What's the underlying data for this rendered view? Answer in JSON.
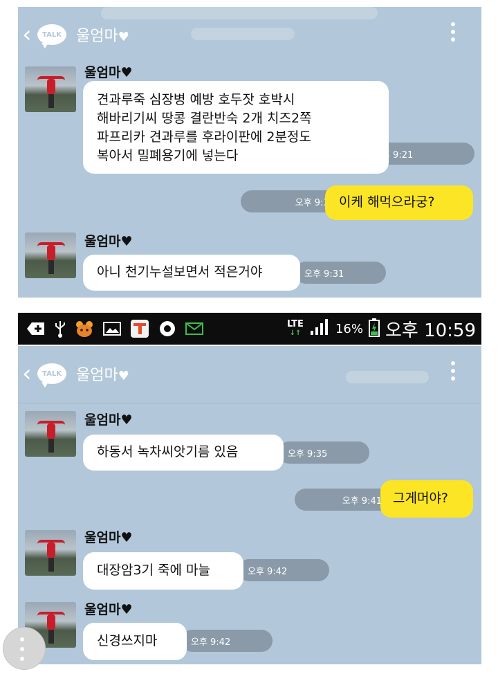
{
  "panel1": {
    "header": {
      "title": "울엄마",
      "heart": "♥",
      "talk_label": "TALK",
      "back": "‹"
    },
    "messages": [
      {
        "sender": "울엄마",
        "heart": "♥",
        "text": "견과루죽  심장병 예방   호두잣 호박시\n해바리기씨  땅콩 결란반숙 2개 치즈2쪽\n파프리카  견과루를 후라이판에 2분정도\n복아서 밀폐용기에 넣는다",
        "time": "오후 9:21"
      },
      {
        "mine": true,
        "text": "이케  해먹으라궁?",
        "time": "오후 9:30"
      },
      {
        "sender": "울엄마",
        "heart": "♥",
        "text": "아니 천기누설보면서 적은거야",
        "time": "오후 9:31"
      }
    ]
  },
  "statusbar": {
    "network": "LTE",
    "battery": "16%",
    "time": "오후 10:59"
  },
  "panel2": {
    "header": {
      "title": "울엄마",
      "heart": "♥",
      "talk_label": "TALK",
      "back": "‹"
    },
    "messages": [
      {
        "sender": "울엄마",
        "heart": "♥",
        "text": "하동서  녹차씨앗기름  있음",
        "time": "오후 9:35"
      },
      {
        "mine": true,
        "text": "그게머야?",
        "time": "오후 9:41"
      },
      {
        "sender": "울엄마",
        "heart": "♥",
        "text": "대장암3기  죽에 마늘",
        "time": "오후 9:42"
      },
      {
        "sender": "울엄마",
        "heart": "♥",
        "text": "신경쓰지마",
        "time": "오후 9:42"
      }
    ]
  },
  "colors": {
    "chat_bg": "#b2c7d9",
    "my_bubble": "#fce525",
    "their_bubble": "#ffffff",
    "time_pill": "#8a9aa8",
    "statusbar": "#0d0d0d"
  },
  "icons": [
    "back-chevron-icon",
    "kakaotalk-logo-icon",
    "kebab-menu-icon",
    "add-icon",
    "usb-icon",
    "character-icon",
    "gallery-icon",
    "t-store-icon",
    "circle-icon",
    "message-icon",
    "signal-icon",
    "battery-charging-icon"
  ]
}
